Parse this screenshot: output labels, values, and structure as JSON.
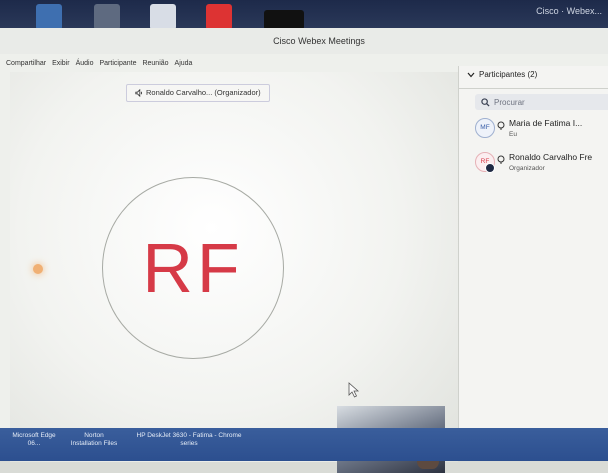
{
  "desktop": {
    "clock": "Cisco · Webex...",
    "bottom_labels": {
      "b1": "Microsoft Edge",
      "b1_sub": "06...",
      "b2": "Norton",
      "b2_sub": "Installation Files",
      "b3": "HP DeskJet 3630 - Fatima - Chrome",
      "b3_sub": "series"
    }
  },
  "window": {
    "title": "Cisco Webex Meetings",
    "menu": [
      "Compartilhar",
      "Exibir",
      "Áudio",
      "Participante",
      "Reunião",
      "Ajuda"
    ]
  },
  "stage": {
    "speaker_label": "Ronaldo Carvalho... (Organizador)",
    "avatar_initials": "RF"
  },
  "participants": {
    "header": "Participantes (2)",
    "search_placeholder": "Procurar",
    "list": [
      {
        "initials": "MF",
        "name": "Maria de Fatima I...",
        "role": "Eu"
      },
      {
        "initials": "RF",
        "name": "Ronaldo Carvalho Fre",
        "role": "Organizador"
      }
    ]
  },
  "icons": {
    "speaker": "speaker-icon",
    "search": "search-icon",
    "chevron": "chevron-down-icon",
    "mic": "microphone-icon",
    "cursor": "mouse-cursor-icon"
  },
  "colors": {
    "initials_red": "#d63a47",
    "mf_blue": "#3b5fa9",
    "taskbar_blue": "#2c4f8f"
  }
}
